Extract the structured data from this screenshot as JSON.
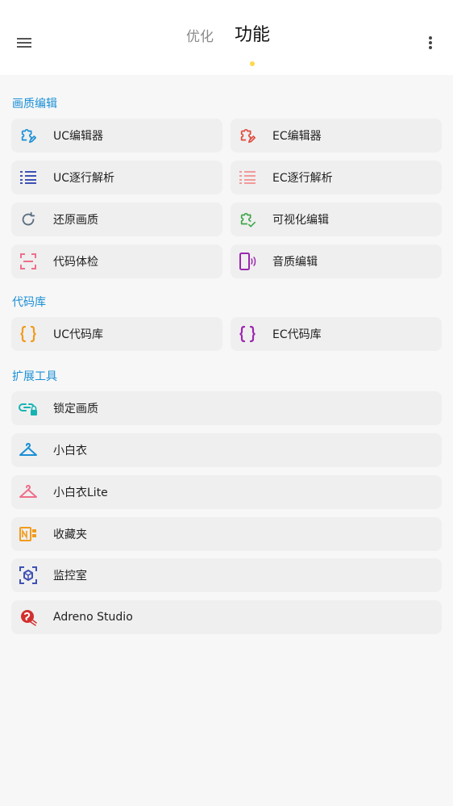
{
  "header": {
    "tabs": [
      {
        "label": "优化",
        "active": false
      },
      {
        "label": "功能",
        "active": true
      }
    ],
    "indicator_color": "#ffd84a",
    "menu_icon": "hamburger-menu-icon",
    "more_icon": "more-vertical-icon"
  },
  "sections": [
    {
      "title": "画质编辑",
      "items": [
        {
          "label": "UC编辑器",
          "icon": "puzzle-edit-icon",
          "color": "#1a8fd6"
        },
        {
          "label": "EC编辑器",
          "icon": "puzzle-edit-icon",
          "color": "#e04a3c"
        },
        {
          "label": "UC逐行解析",
          "icon": "list-icon",
          "color": "#3f51b5"
        },
        {
          "label": "EC逐行解析",
          "icon": "list-icon",
          "color": "#f29a9a"
        },
        {
          "label": "还原画质",
          "icon": "restore-icon",
          "color": "#5a6e80"
        },
        {
          "label": "可视化编辑",
          "icon": "puzzle-check-icon",
          "color": "#3fa64a"
        },
        {
          "label": "代码体检",
          "icon": "scan-icon",
          "color": "#ef6f8a"
        },
        {
          "label": "音质编辑",
          "icon": "phone-sound-icon",
          "color": "#9c27b0"
        }
      ]
    },
    {
      "title": "代码库",
      "items": [
        {
          "label": "UC代码库",
          "icon": "braces-icon",
          "color": "#f29b1d"
        },
        {
          "label": "EC代码库",
          "icon": "braces-icon",
          "color": "#9c27b0"
        }
      ]
    },
    {
      "title": "扩展工具",
      "items": [
        {
          "label": "锁定画质",
          "icon": "link-lock-icon",
          "color": "#17b3b3"
        },
        {
          "label": "小白衣",
          "icon": "hanger-icon",
          "color": "#1a8fd6"
        },
        {
          "label": "小白衣Lite",
          "icon": "hanger-icon",
          "color": "#ef6f8a"
        },
        {
          "label": "收藏夹",
          "icon": "notebook-icon",
          "color": "#f29b1d"
        },
        {
          "label": "监控室",
          "icon": "cube-scan-icon",
          "color": "#3f51b5"
        },
        {
          "label": "Adreno Studio",
          "icon": "snapdragon-icon",
          "color": "#d32f2f"
        }
      ]
    }
  ]
}
